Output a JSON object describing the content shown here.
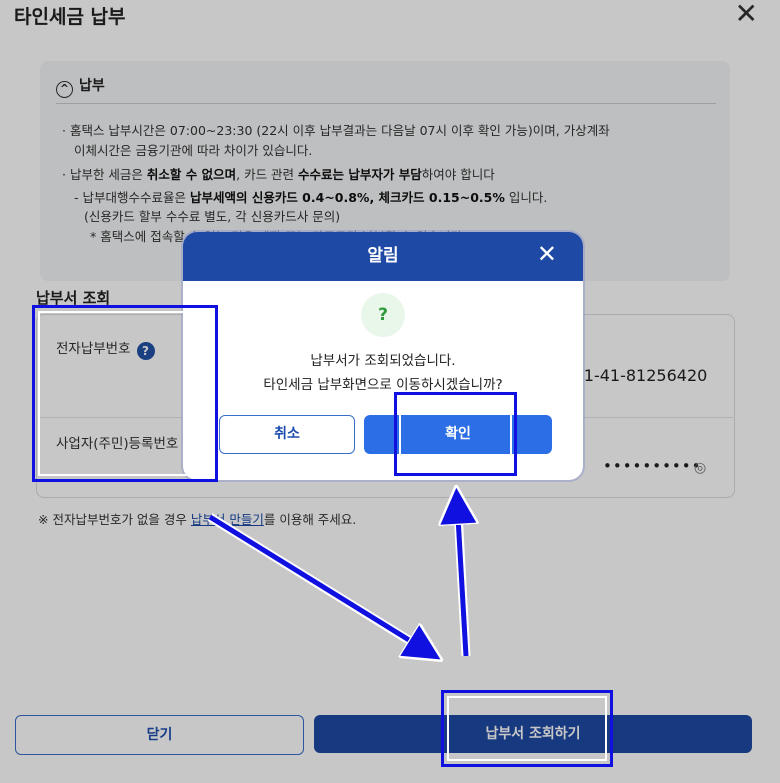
{
  "window": {
    "title": "타인세금 납부"
  },
  "notice": {
    "heading": "납부",
    "line1": "· 홈택스 납부시간은 07:00~23:30 (22시 이후 납부결과는 다음날 07시 이후 확인 가능)이며, 가상계좌",
    "line1b": "이체시간은 금융기관에 따라 차이가 있습니다.",
    "line2_pre": "· 납부한 세금은 ",
    "line2_b1": "취소할 수 없으며",
    "line2_mid": ", 카드 관련 ",
    "line2_b2": "수수료는 납부자가 부담",
    "line2_post": "하여야 합니다",
    "line3_pre": "- 납부대행수수료율은 ",
    "line3_b": "납부세액의 신용카드 0.4~0.8%, 체크카드 0.15~0.5%",
    "line3_post": " 입니다.",
    "line4": "(신용카드 할부 수수료 별도, 각 신용카드사 문의)",
    "line5": "* 홈택스에 접속할 수 없는 경우 계좌 또는 카드로만 납부할 수 있습니다."
  },
  "lookup": {
    "section_title": "납부서 조회",
    "field1_label": "전자납부번호",
    "field1_value": "-1-41-81256420",
    "field2_label": "사업자(주민)등록번호",
    "field2_value": "••••••••••"
  },
  "footnote": {
    "pre": "※ 전자납부번호가 없을 경우 ",
    "link": "납부서 만들기",
    "post": "를 이용해 주세요."
  },
  "buttons": {
    "close": "닫기",
    "submit": "납부서 조회하기"
  },
  "modal": {
    "title": "알림",
    "icon": "?",
    "message1": "납부서가 조회되었습니다.",
    "message2": "타인세금 납부화면으로 이동하시겠습니까?",
    "cancel": "취소",
    "confirm": "확인"
  },
  "colors": {
    "primary": "#1e4aa5",
    "confirm": "#2b6ee6",
    "annotation": "#1010e0"
  }
}
